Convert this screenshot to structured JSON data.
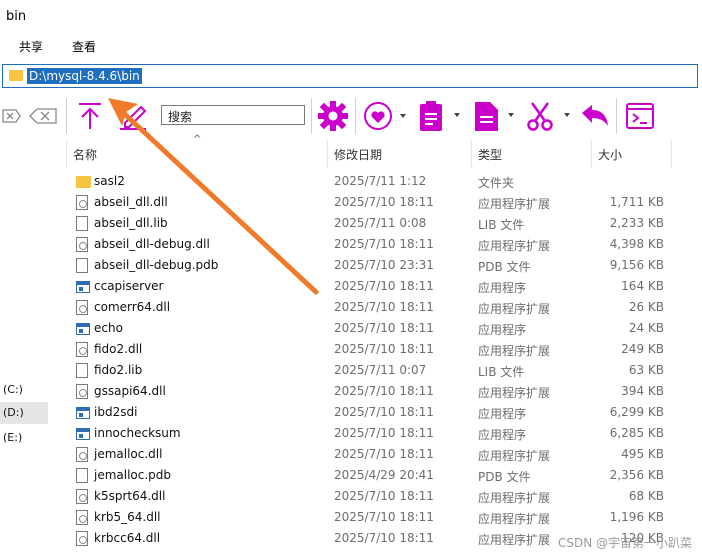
{
  "window": {
    "title": "bin"
  },
  "ribbon": {
    "tabs": [
      "共享",
      "查看"
    ]
  },
  "address": {
    "path": "D:\\mysql-8.4.6\\bin"
  },
  "search": {
    "placeholder": "搜索"
  },
  "columns": {
    "name": "名称",
    "date": "修改日期",
    "type": "类型",
    "size": "大小"
  },
  "drives": [
    "(C:)",
    "(D:)",
    "(E:)"
  ],
  "files": [
    {
      "icon": "folder",
      "name": "sasl2",
      "date": "2025/7/11 1:12",
      "type": "文件夹",
      "size": ""
    },
    {
      "icon": "dll",
      "name": "abseil_dll.dll",
      "date": "2025/7/10 18:11",
      "type": "应用程序扩展",
      "size": "1,711 KB"
    },
    {
      "icon": "file",
      "name": "abseil_dll.lib",
      "date": "2025/7/11 0:08",
      "type": "LIB 文件",
      "size": "2,233 KB"
    },
    {
      "icon": "dll",
      "name": "abseil_dll-debug.dll",
      "date": "2025/7/10 18:11",
      "type": "应用程序扩展",
      "size": "4,398 KB"
    },
    {
      "icon": "file",
      "name": "abseil_dll-debug.pdb",
      "date": "2025/7/10 23:31",
      "type": "PDB 文件",
      "size": "9,156 KB"
    },
    {
      "icon": "exe",
      "name": "ccapiserver",
      "date": "2025/7/10 18:11",
      "type": "应用程序",
      "size": "164 KB"
    },
    {
      "icon": "dll",
      "name": "comerr64.dll",
      "date": "2025/7/10 18:11",
      "type": "应用程序扩展",
      "size": "26 KB"
    },
    {
      "icon": "exe",
      "name": "echo",
      "date": "2025/7/10 18:11",
      "type": "应用程序",
      "size": "24 KB"
    },
    {
      "icon": "dll",
      "name": "fido2.dll",
      "date": "2025/7/10 18:11",
      "type": "应用程序扩展",
      "size": "249 KB"
    },
    {
      "icon": "file",
      "name": "fido2.lib",
      "date": "2025/7/11 0:07",
      "type": "LIB 文件",
      "size": "63 KB"
    },
    {
      "icon": "dll",
      "name": "gssapi64.dll",
      "date": "2025/7/10 18:11",
      "type": "应用程序扩展",
      "size": "394 KB"
    },
    {
      "icon": "exe",
      "name": "ibd2sdi",
      "date": "2025/7/10 18:11",
      "type": "应用程序",
      "size": "6,299 KB"
    },
    {
      "icon": "exe",
      "name": "innochecksum",
      "date": "2025/7/10 18:11",
      "type": "应用程序",
      "size": "6,285 KB"
    },
    {
      "icon": "dll",
      "name": "jemalloc.dll",
      "date": "2025/7/10 18:11",
      "type": "应用程序扩展",
      "size": "495 KB"
    },
    {
      "icon": "file",
      "name": "jemalloc.pdb",
      "date": "2025/4/29 20:41",
      "type": "PDB 文件",
      "size": "2,356 KB"
    },
    {
      "icon": "dll",
      "name": "k5sprt64.dll",
      "date": "2025/7/10 18:11",
      "type": "应用程序扩展",
      "size": "68 KB"
    },
    {
      "icon": "dll",
      "name": "krb5_64.dll",
      "date": "2025/7/10 18:11",
      "type": "应用程序扩展",
      "size": "1,196 KB"
    },
    {
      "icon": "dll",
      "name": "krbcc64.dll",
      "date": "2025/7/10 18:11",
      "type": "应用程序扩展",
      "size": "120 KB"
    }
  ],
  "watermark": "CSDN @宇宙第一小趴菜",
  "colors": {
    "accent": "#cc00cc",
    "annotation_arrow": "#f07a2a",
    "selection": "#1e6fbf"
  }
}
